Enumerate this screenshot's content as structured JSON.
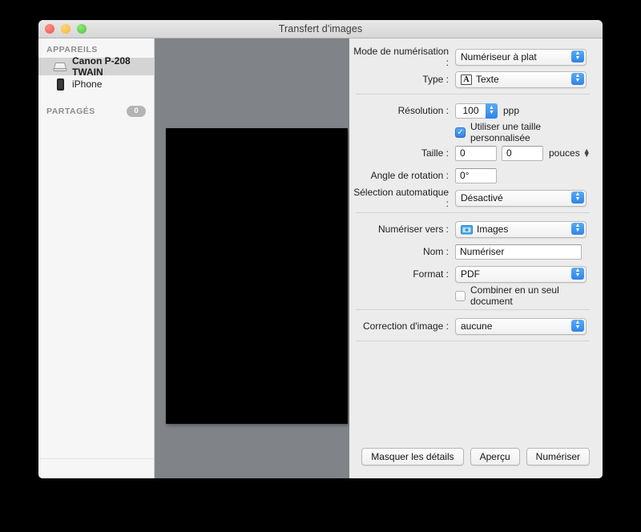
{
  "window": {
    "title": "Transfert d'images",
    "traffic_lights": [
      "close",
      "minimize",
      "maximize"
    ]
  },
  "sidebar": {
    "sections": [
      {
        "header": "APPAREILS",
        "badge": null,
        "items": [
          {
            "label": "Canon P-208 TWAIN",
            "icon": "scanner-icon",
            "selected": true
          },
          {
            "label": "iPhone",
            "icon": "iphone-icon",
            "selected": false
          }
        ]
      },
      {
        "header": "PARTAGÉS",
        "badge": "0",
        "items": []
      }
    ]
  },
  "settings": {
    "scan_mode": {
      "label": "Mode de numérisation :",
      "value": "Numériseur à plat"
    },
    "type": {
      "label": "Type :",
      "value": "Texte",
      "icon": "text-A-icon"
    },
    "resolution": {
      "label": "Résolution :",
      "value": "100",
      "unit": "ppp"
    },
    "custom_size": {
      "label": "Utiliser une taille personnalisée",
      "checked": true
    },
    "size": {
      "label": "Taille :",
      "width": "0",
      "height": "0",
      "unit": "pouces"
    },
    "rotation": {
      "label": "Angle de rotation :",
      "value": "0°"
    },
    "auto_selection": {
      "label": "Sélection automatique :",
      "value": "Désactivé"
    },
    "scan_to": {
      "label": "Numériser vers :",
      "value": "Images",
      "icon": "pictures-folder-icon"
    },
    "name": {
      "label": "Nom :",
      "value": "Numériser"
    },
    "format": {
      "label": "Format :",
      "value": "PDF"
    },
    "combine": {
      "label": "Combiner en un seul document",
      "checked": false
    },
    "image_correction": {
      "label": "Correction d'image :",
      "value": "aucune"
    }
  },
  "buttons": {
    "hide_details": "Masquer les détails",
    "preview": "Aperçu",
    "scan": "Numériser"
  },
  "colors": {
    "accent_blue": "#2f84e8",
    "window_chrome": "#ececec",
    "preview_background": "#808488",
    "scan_area": "#000000",
    "sidebar_background": "#f6f6f6",
    "selection": "#d4d4d4"
  }
}
